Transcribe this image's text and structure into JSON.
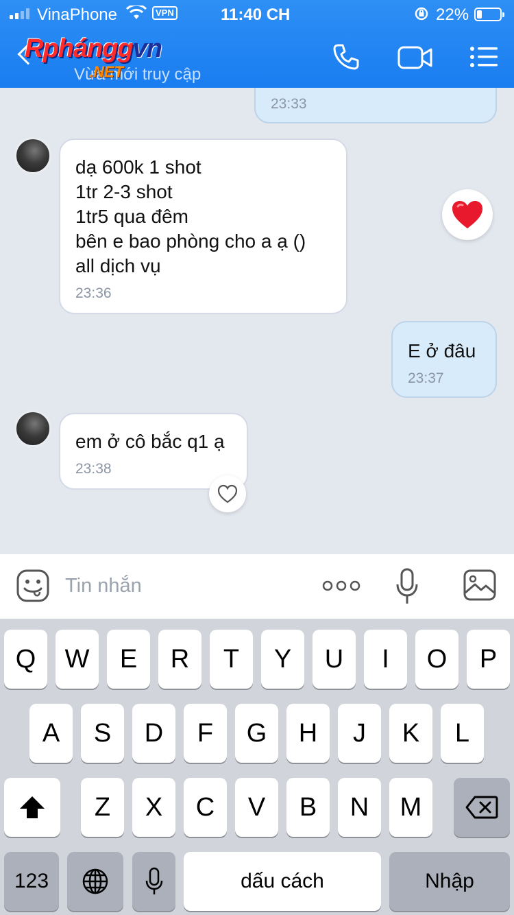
{
  "status_bar": {
    "carrier": "VinaPhone",
    "vpn": "VPN",
    "time": "11:40 CH",
    "battery": "22%",
    "battery_level": 0.22
  },
  "header": {
    "watermark_brand": "Rphánggvn",
    "watermark_net": ".NET",
    "presence": "Vừa mới truy cập",
    "icons": [
      "back-icon",
      "phone-icon",
      "video-icon",
      "menu-icon"
    ]
  },
  "messages": [
    {
      "side": "out",
      "text": "",
      "time": "23:33"
    },
    {
      "side": "in",
      "text": "dạ 600k 1 shot\n1tr   2-3 shot\n1tr5 qua đêm\nbên e bao phòng cho a ạ ()\nall dịch vụ",
      "time": "23:36",
      "reaction": "heart-filled-icon"
    },
    {
      "side": "out",
      "text": "E ở đâu",
      "time": "23:37"
    },
    {
      "side": "in",
      "text": "em ở cô bắc q1 ạ",
      "time": "23:38",
      "reaction": "heart-outline-icon"
    }
  ],
  "input": {
    "placeholder": "Tin nhắn",
    "icons": [
      "sticker-icon",
      "more-icon",
      "microphone-icon",
      "image-icon"
    ]
  },
  "keyboard": {
    "row1": [
      "Q",
      "W",
      "E",
      "R",
      "T",
      "Y",
      "U",
      "I",
      "O",
      "P"
    ],
    "row2": [
      "A",
      "S",
      "D",
      "F",
      "G",
      "H",
      "J",
      "K",
      "L"
    ],
    "row3": [
      "Z",
      "X",
      "C",
      "V",
      "B",
      "N",
      "M"
    ],
    "numbers": "123",
    "space": "dấu cách",
    "return": "Nhập"
  },
  "colors": {
    "header": "#1a7df0",
    "incoming_bubble": "#ffffff",
    "outgoing_bubble": "#d7ebfb",
    "chat_background": "#e3e8ef",
    "heart": "#e8192c"
  }
}
